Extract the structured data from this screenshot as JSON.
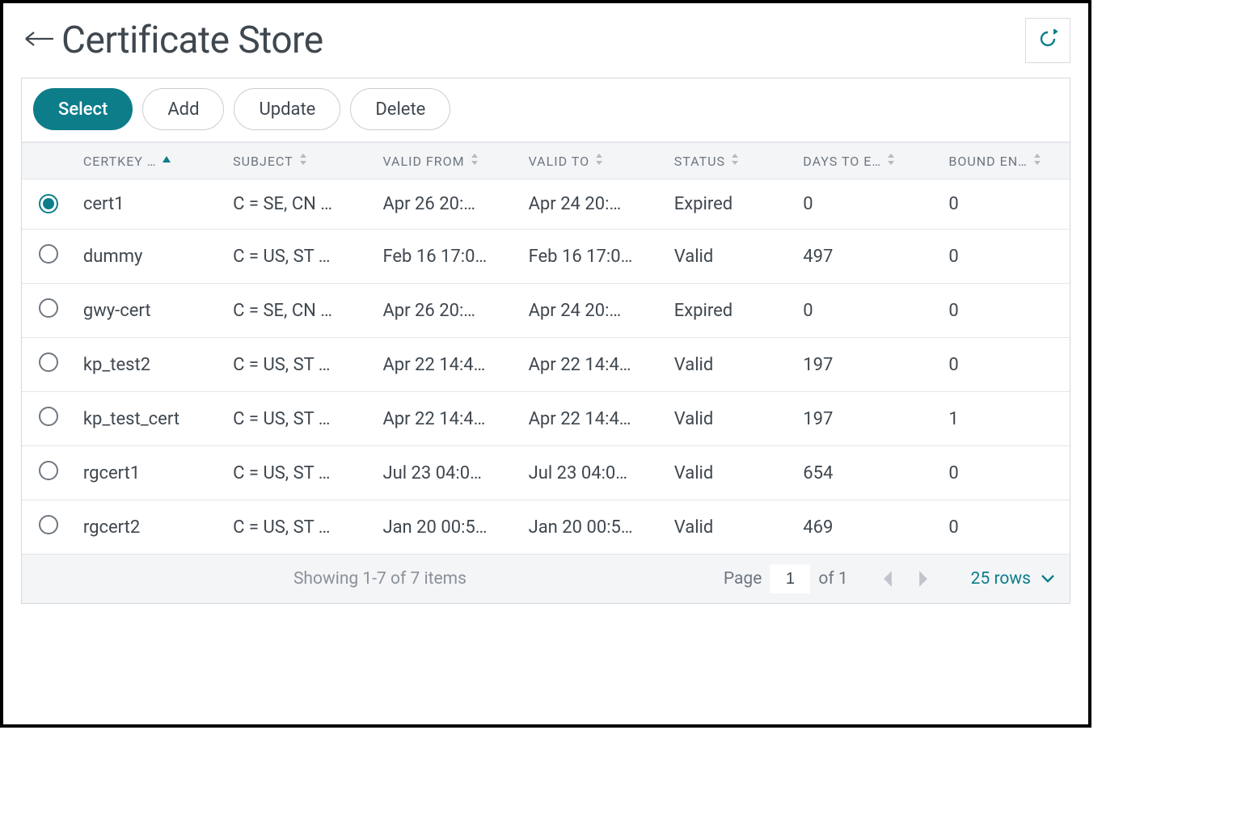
{
  "header": {
    "title": "Certificate Store"
  },
  "toolbar": {
    "select_label": "Select",
    "add_label": "Add",
    "update_label": "Update",
    "delete_label": "Delete"
  },
  "columns": {
    "certkey": "CERTKEY …",
    "subject": "SUBJECT",
    "valid_from": "VALID FROM",
    "valid_to": "VALID TO",
    "status": "STATUS",
    "days_to_expire": "DAYS TO E…",
    "bound_entities": "BOUND EN…"
  },
  "rows": [
    {
      "selected": true,
      "certkey": "cert1",
      "subject": "C = SE, CN …",
      "valid_from": "Apr 26 20:…",
      "valid_to": "Apr 24 20:…",
      "status": "Expired",
      "days": "0",
      "bound": "0"
    },
    {
      "selected": false,
      "certkey": "dummy",
      "subject": "C = US, ST …",
      "valid_from": "Feb 16 17:0…",
      "valid_to": "Feb 16 17:0…",
      "status": "Valid",
      "days": "497",
      "bound": "0"
    },
    {
      "selected": false,
      "certkey": "gwy-cert",
      "subject": "C = SE, CN …",
      "valid_from": "Apr 26 20:…",
      "valid_to": "Apr 24 20:…",
      "status": "Expired",
      "days": "0",
      "bound": "0"
    },
    {
      "selected": false,
      "certkey": "kp_test2",
      "subject": "C = US, ST …",
      "valid_from": "Apr 22 14:4…",
      "valid_to": "Apr 22 14:4…",
      "status": "Valid",
      "days": "197",
      "bound": "0"
    },
    {
      "selected": false,
      "certkey": "kp_test_cert",
      "subject": "C = US, ST …",
      "valid_from": "Apr 22 14:4…",
      "valid_to": "Apr 22 14:4…",
      "status": "Valid",
      "days": "197",
      "bound": "1"
    },
    {
      "selected": false,
      "certkey": "rgcert1",
      "subject": "C = US, ST …",
      "valid_from": "Jul 23 04:0…",
      "valid_to": "Jul 23 04:0…",
      "status": "Valid",
      "days": "654",
      "bound": "0"
    },
    {
      "selected": false,
      "certkey": "rgcert2",
      "subject": "C = US, ST …",
      "valid_from": "Jan 20 00:5…",
      "valid_to": "Jan 20 00:5…",
      "status": "Valid",
      "days": "469",
      "bound": "0"
    }
  ],
  "footer": {
    "status": "Showing 1-7 of 7 items",
    "page_label": "Page",
    "page_value": "1",
    "of_label": "of 1",
    "rows_label": "25 rows"
  }
}
